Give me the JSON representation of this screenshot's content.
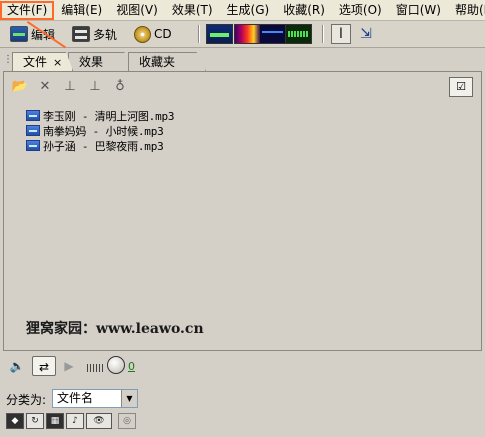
{
  "menu": [
    {
      "label": "文件(F)",
      "active": true
    },
    {
      "label": "编辑(E)"
    },
    {
      "label": "视图(V)"
    },
    {
      "label": "效果(T)"
    },
    {
      "label": "生成(G)"
    },
    {
      "label": "收藏(R)"
    },
    {
      "label": "选项(O)"
    },
    {
      "label": "窗口(W)"
    },
    {
      "label": "帮助(H)"
    }
  ],
  "toolbar": {
    "edit_label": "编辑",
    "multitrack_label": "多轨",
    "cd_label": "CD"
  },
  "tabs": [
    {
      "label": "文件",
      "close": "×"
    },
    {
      "label": "效果"
    },
    {
      "label": "收藏夹"
    }
  ],
  "files": [
    {
      "name": "李玉刚 - 清明上河图.mp3"
    },
    {
      "name": "南拳妈妈 - 小时候.mp3"
    },
    {
      "name": "孙子涵 - 巴黎夜雨.mp3"
    }
  ],
  "watermark": "狸窝家园：www.leawo.cn",
  "transport": {
    "volume": "0"
  },
  "sort": {
    "label": "分类为:",
    "value": "文件名"
  },
  "colors": {
    "highlight": "#ff6a2b"
  }
}
